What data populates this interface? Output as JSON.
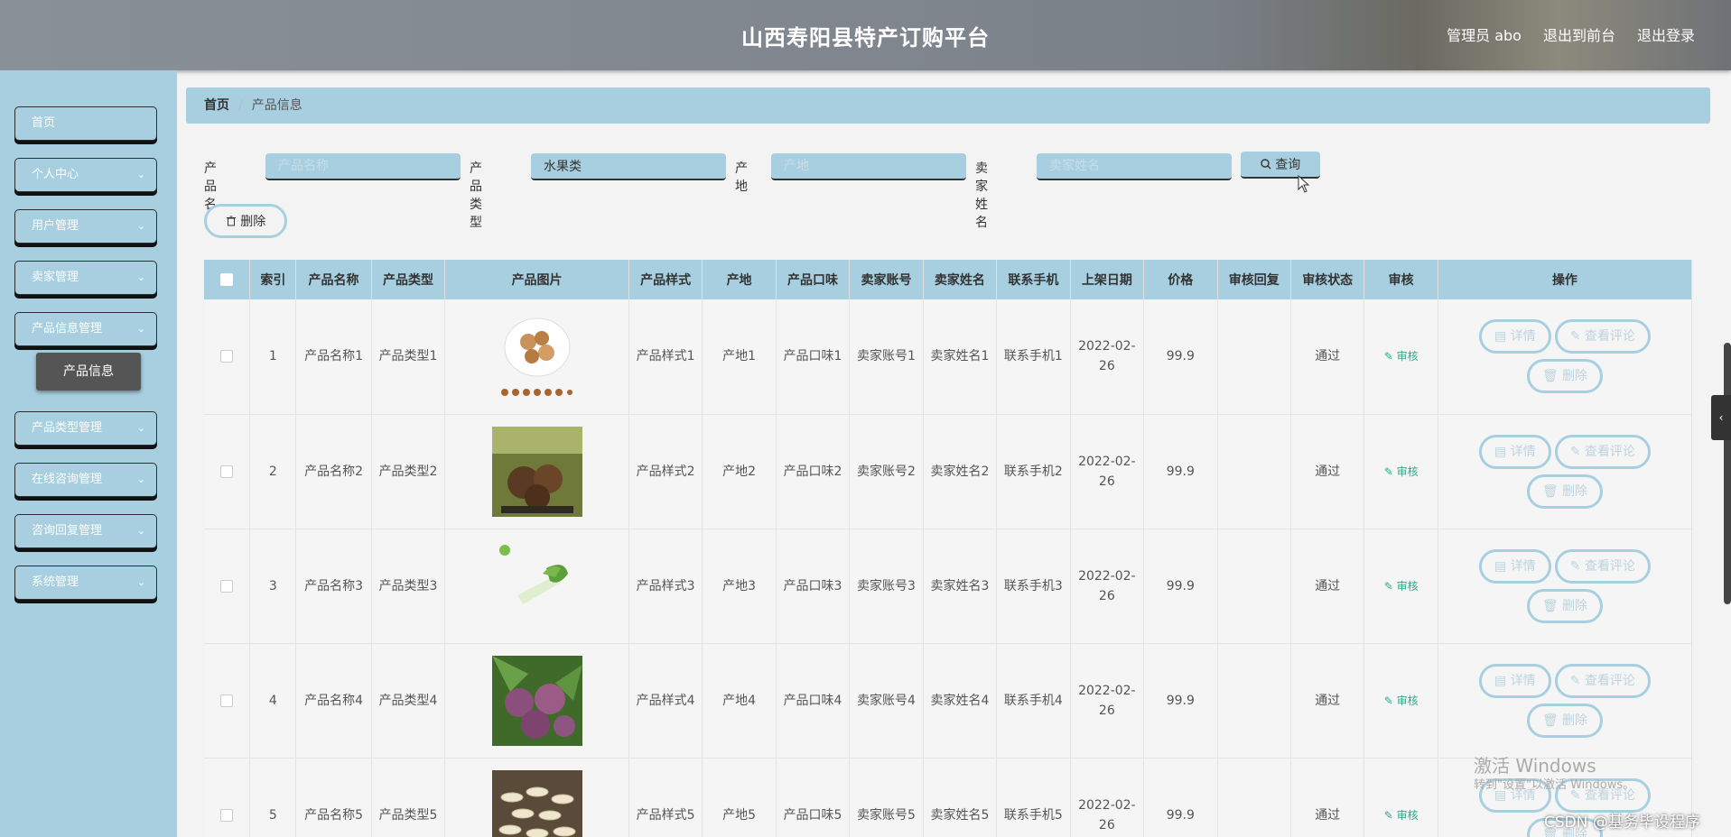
{
  "header": {
    "title": "山西寿阳县特产订购平台",
    "admin": "管理员 abo",
    "back_front": "退出到前台",
    "logout": "退出登录"
  },
  "sidebar": {
    "items": [
      {
        "label": "首页",
        "chevron": ""
      },
      {
        "label": "个人中心",
        "chevron": "⌄"
      },
      {
        "label": "用户管理",
        "chevron": "⌄"
      },
      {
        "label": "卖家管理",
        "chevron": "⌄"
      },
      {
        "label": "产品信息管理",
        "chevron": "⌄"
      },
      {
        "label": "产品类型管理",
        "chevron": "⌄"
      },
      {
        "label": "在线咨询管理",
        "chevron": "⌄"
      },
      {
        "label": "咨询回复管理",
        "chevron": "⌄"
      },
      {
        "label": "系统管理",
        "chevron": "⌄"
      }
    ],
    "sub_item": "产品信息"
  },
  "breadcrumb": {
    "home": "首页",
    "separator": "/",
    "current": "产品信息"
  },
  "filters": {
    "name_label": "产品名称",
    "name_placeholder": "产品名称",
    "type_label": "产品类型",
    "type_value": "水果类",
    "origin_label": "产地",
    "origin_placeholder": "产地",
    "seller_label": "卖家姓名",
    "seller_placeholder": "卖家姓名",
    "query_button": "查询"
  },
  "delete_button": "删除",
  "table": {
    "columns": [
      "",
      "索引",
      "产品名称",
      "产品类型",
      "产品图片",
      "产品样式",
      "产地",
      "产品口味",
      "卖家账号",
      "卖家姓名",
      "联系手机",
      "上架日期",
      "价格",
      "审核回复",
      "审核状态",
      "审核",
      "操作"
    ],
    "rows": [
      {
        "index": "1",
        "name": "产品名称1",
        "type": "产品类型1",
        "image": "dried-fruit-plate",
        "style": "产品样式1",
        "origin": "产地1",
        "taste": "产品口味1",
        "seller_account": "卖家账号1",
        "seller_name": "卖家姓名1",
        "phone": "联系手机1",
        "date": "2022-02-26",
        "price": "99.9",
        "reply": "",
        "status": "通过",
        "audit": "审核"
      },
      {
        "index": "2",
        "name": "产品名称2",
        "type": "产品类型2",
        "image": "mushroom-package",
        "style": "产品样式2",
        "origin": "产地2",
        "taste": "产品口味2",
        "seller_account": "卖家账号2",
        "seller_name": "卖家姓名2",
        "phone": "联系手机2",
        "date": "2022-02-26",
        "price": "99.9",
        "reply": "",
        "status": "通过",
        "audit": "审核"
      },
      {
        "index": "3",
        "name": "产品名称3",
        "type": "产品类型3",
        "image": "green-vegetable",
        "style": "产品样式3",
        "origin": "产地3",
        "taste": "产品口味3",
        "seller_account": "卖家账号3",
        "seller_name": "卖家姓名3",
        "phone": "联系手机3",
        "date": "2022-02-26",
        "price": "99.9",
        "reply": "",
        "status": "通过",
        "audit": "审核"
      },
      {
        "index": "4",
        "name": "产品名称4",
        "type": "产品类型4",
        "image": "purple-fruit",
        "style": "产品样式4",
        "origin": "产地4",
        "taste": "产品口味4",
        "seller_account": "卖家账号4",
        "seller_name": "卖家姓名4",
        "phone": "联系手机4",
        "date": "2022-02-26",
        "price": "99.9",
        "reply": "",
        "status": "通过",
        "audit": "审核"
      },
      {
        "index": "5",
        "name": "产品名称5",
        "type": "产品类型5",
        "image": "seeds-pile",
        "style": "产品样式5",
        "origin": "产地5",
        "taste": "产品口味5",
        "seller_account": "卖家账号5",
        "seller_name": "卖家姓名5",
        "phone": "联系手机5",
        "date": "2022-02-26",
        "price": "99.9",
        "reply": "",
        "status": "通过",
        "audit": "审核"
      }
    ],
    "ops": {
      "detail": "详情",
      "comments": "查看评论",
      "delete": "删除"
    }
  },
  "overlay": {
    "activate_title": "激活 Windows",
    "activate_sub": "转到\"设置\"以激活 Windows。",
    "csdn": "CSDN @基务毕设程序"
  },
  "colors": {
    "accent": "#a7cfe0",
    "audit_green": "#2ea88a"
  }
}
